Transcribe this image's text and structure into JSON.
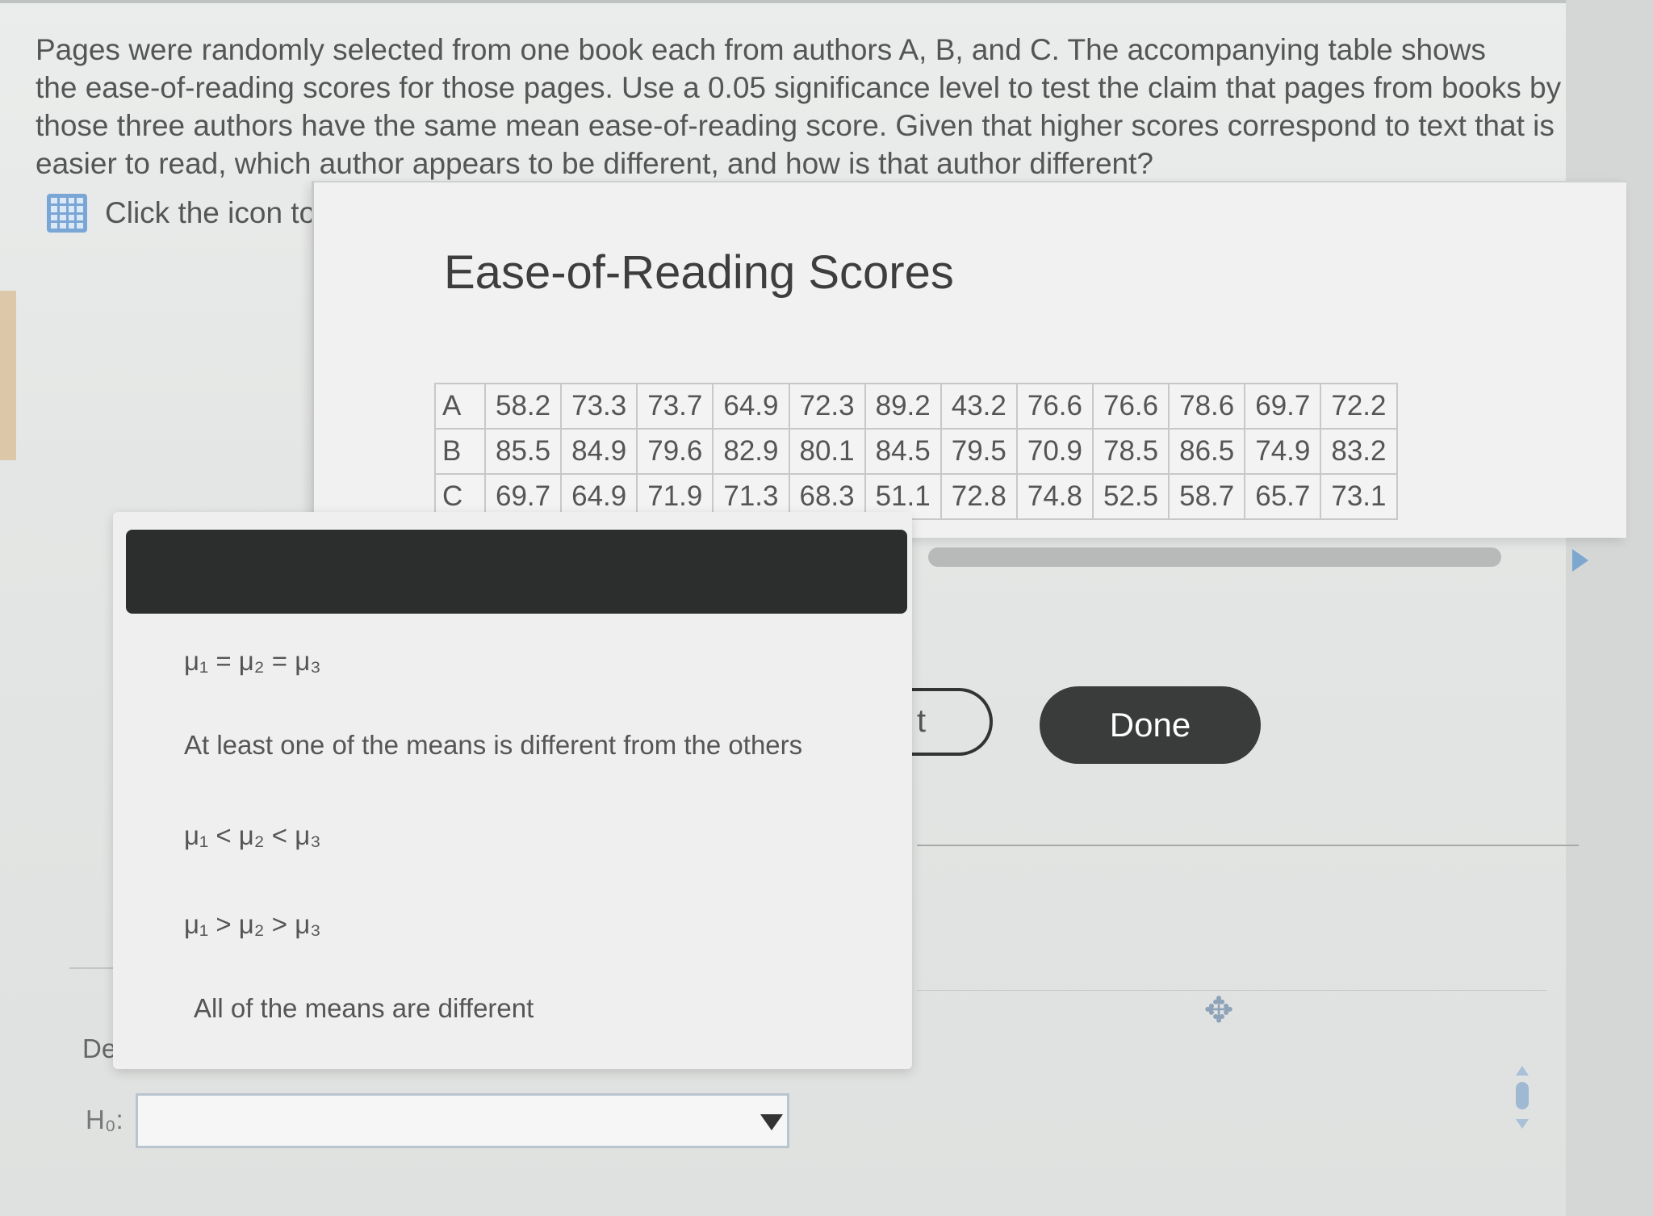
{
  "question": {
    "lines": [
      "Pages were randomly selected from one book each from authors A, B, and C. The accompanying table shows",
      "the ease-of-reading scores for those pages. Use a 0.05 significance level to test the claim that pages from books by",
      "those three authors have the same mean ease-of-reading score. Given that higher scores correspond to text that is",
      "easier to read, which author appears to be different, and how is that author different?"
    ]
  },
  "data_link": {
    "text": "Click the icon to",
    "icon": "grid-icon"
  },
  "popup": {
    "title": "Ease-of-Reading Scores",
    "rows": [
      {
        "label": "A",
        "values": [
          "58.2",
          "73.3",
          "73.7",
          "64.9",
          "72.3",
          "89.2",
          "43.2",
          "76.6",
          "76.6",
          "78.6",
          "69.7",
          "72.2"
        ]
      },
      {
        "label": "B",
        "values": [
          "85.5",
          "84.9",
          "79.6",
          "82.9",
          "80.1",
          "84.5",
          "79.5",
          "70.9",
          "78.5",
          "86.5",
          "74.9",
          "83.2"
        ]
      },
      {
        "label": "C",
        "values": [
          "69.7",
          "64.9",
          "71.9",
          "71.3",
          "68.3",
          "51.1",
          "72.8",
          "74.8",
          "52.5",
          "58.7",
          "65.7",
          "73.1"
        ]
      }
    ],
    "partial_button": "t",
    "done_label": "Done"
  },
  "dropdown": {
    "options": [
      "μ₁ = μ₂ = μ₃",
      "At least one of the means is different from the others",
      "μ₁ < μ₂ < μ₃",
      "μ₁ > μ₂ > μ₃",
      "All of the means are different"
    ]
  },
  "form": {
    "determine_text": "Dete...",
    "h0_label": "H₀:",
    "h0_value": ""
  },
  "colors": {
    "done_bg": "#3a3b3b",
    "dropdown_header": "#2c2e2d",
    "link_icon": "#7aa6d6"
  }
}
